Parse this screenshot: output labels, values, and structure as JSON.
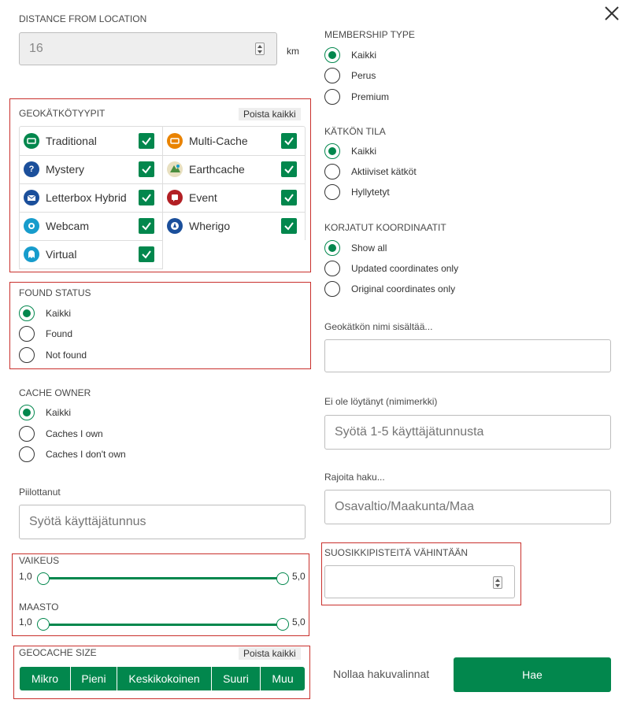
{
  "close_icon": "close-icon",
  "distance": {
    "label": "DISTANCE FROM LOCATION",
    "value": "16",
    "unit": "km"
  },
  "geocache_types": {
    "label": "GEOKÄTKÖTYYPIT",
    "clear_label": "Poista kaikki",
    "items": [
      {
        "name": "Traditional",
        "checked": true,
        "icon": "traditional-icon",
        "color": "#02874d"
      },
      {
        "name": "Multi-Cache",
        "checked": true,
        "icon": "multi-cache-icon",
        "color": "#e98300"
      },
      {
        "name": "Mystery",
        "checked": true,
        "icon": "mystery-icon",
        "color": "#1b4f9b"
      },
      {
        "name": "Earthcache",
        "checked": true,
        "icon": "earthcache-icon",
        "color": "#4b8e3f"
      },
      {
        "name": "Letterbox Hybrid",
        "checked": true,
        "icon": "letterbox-icon",
        "color": "#1b4f9b"
      },
      {
        "name": "Event",
        "checked": true,
        "icon": "event-icon",
        "color": "#b21f24"
      },
      {
        "name": "Webcam",
        "checked": true,
        "icon": "webcam-icon",
        "color": "#179ccc"
      },
      {
        "name": "Wherigo",
        "checked": true,
        "icon": "wherigo-icon",
        "color": "#1b4f9b"
      },
      {
        "name": "Virtual",
        "checked": true,
        "icon": "virtual-icon",
        "color": "#179ccc"
      }
    ]
  },
  "found_status": {
    "label": "FOUND STATUS",
    "options": [
      "Kaikki",
      "Found",
      "Not found"
    ],
    "selected": "Kaikki"
  },
  "cache_owner": {
    "label": "CACHE OWNER",
    "options": [
      "Kaikki",
      "Caches I own",
      "Caches I don't own"
    ],
    "selected": "Kaikki"
  },
  "hidden_by": {
    "label": "Piilottanut",
    "placeholder": "Syötä käyttäjätunnus"
  },
  "difficulty": {
    "label": "VAIKEUS",
    "min_label": "1,0",
    "max_label": "5,0",
    "min": 1.0,
    "max": 5.0
  },
  "terrain": {
    "label": "MAASTO",
    "min_label": "1,0",
    "max_label": "5,0",
    "min": 1.0,
    "max": 5.0
  },
  "geocache_size": {
    "label": "GEOCACHE SIZE",
    "clear_label": "Poista kaikki",
    "options": [
      "Mikro",
      "Pieni",
      "Keskikokoinen",
      "Suuri",
      "Muu"
    ]
  },
  "membership_type": {
    "label": "MEMBERSHIP TYPE",
    "options": [
      "Kaikki",
      "Perus",
      "Premium"
    ],
    "selected": "Kaikki"
  },
  "cache_status": {
    "label": "KÄTKÖN TILA",
    "options": [
      "Kaikki",
      "Aktiiviset kätköt",
      "Hyllytetyt"
    ],
    "selected": "Kaikki"
  },
  "corrected_coords": {
    "label": "KORJATUT KOORDINAATIT",
    "options": [
      "Show all",
      "Updated coordinates only",
      "Original coordinates only"
    ],
    "selected": "Show all"
  },
  "name_contains": {
    "label": "Geokätkön nimi sisältää...",
    "value": ""
  },
  "not_found_by": {
    "label": "Ei ole löytänyt (nimimerkki)",
    "placeholder": "Syötä 1-5 käyttäjätunnusta"
  },
  "limit_search": {
    "label": "Rajoita haku...",
    "placeholder": "Osavaltio/Maakunta/Maa"
  },
  "min_favorites": {
    "label": "SUOSIKKIPISTEITÄ VÄHINTÄÄN",
    "value": ""
  },
  "actions": {
    "reset_label": "Nollaa hakuvalinnat",
    "search_label": "Hae"
  },
  "colors": {
    "accent": "#02874d",
    "highlight_border": "#c9302c"
  }
}
